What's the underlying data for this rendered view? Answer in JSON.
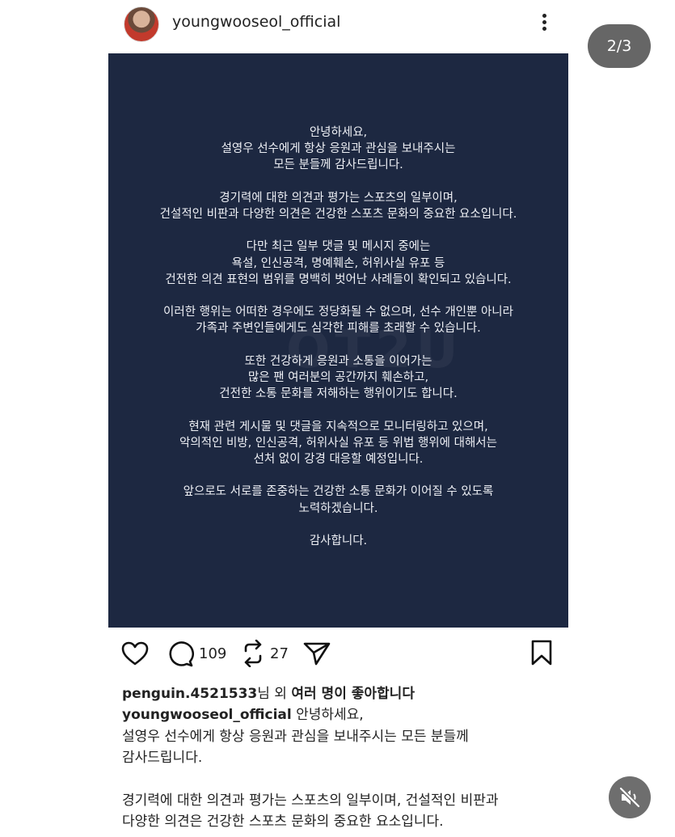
{
  "header": {
    "username": "youngwooseol_official",
    "page_indicator": "2/3"
  },
  "post": {
    "paragraphs": [
      [
        "안녕하세요,",
        "설영우 선수에게 항상 응원과 관심을 보내주시는",
        "모든 분들께 감사드립니다."
      ],
      [
        "경기력에 대한 의견과 평가는 스포츠의 일부이며,",
        "건설적인 비판과 다양한 의견은 건강한 스포츠 문화의 중요한 요소입니다."
      ],
      [
        "다만 최근 일부 댓글 및 메시지 중에는",
        "욕설, 인신공격, 명예훼손, 허위사실 유포 등",
        "건전한 의견 표현의 범위를 명백히 벗어난 사례들이 확인되고 있습니다."
      ],
      [
        "이러한 행위는 어떠한 경우에도 정당화될 수 없으며, 선수 개인뿐 아니라",
        "가족과 주변인들에게도 심각한 피해를 초래할 수 있습니다."
      ],
      [
        "또한 건강하게 응원과 소통을 이어가는",
        "많은 팬 여러분의 공간까지 훼손하고,",
        "건전한 소통 문화를 저해하는 행위이기도 합니다."
      ],
      [
        "현재 관련 게시물 및 댓글을 지속적으로 모니터링하고 있으며,",
        "악의적인 비방, 인신공격, 허위사실 유포 등 위법 행위에 대해서는",
        "선처 없이 강경 대응할 예정입니다."
      ],
      [
        "앞으로도 서로를 존중하는 건강한 소통 문화가 이어질 수 있도록",
        "노력하겠습니다."
      ],
      [
        "감사합니다."
      ]
    ]
  },
  "actions": {
    "comment_count": "109",
    "repost_count": "27"
  },
  "likes": {
    "user": "penguin.4521533",
    "suffix1": "님 외 ",
    "suffix2": "여러 명이 좋아합니다"
  },
  "caption": {
    "user": "youngwooseol_official",
    "first": " 안녕하세요,",
    "line2": "설영우 선수에게 항상 응원과 관심을 보내주시는 모든 분들께",
    "line3": "감사드립니다.",
    "line4": "경기력에 대한 의견과 평가는 스포츠의 일부이며, 건설적인 비판과",
    "line5": "다양한 의견은 건강한 스포츠 문화의 중요한 요소입니다."
  },
  "colors": {
    "post_bg": "#1d2841",
    "post_text": "#eef0f5"
  }
}
